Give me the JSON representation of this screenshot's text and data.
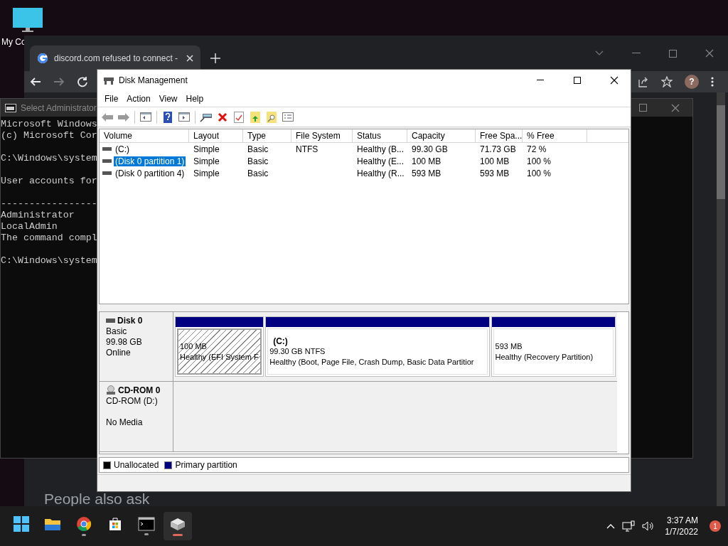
{
  "desktop_icons": [
    {
      "label": "My Co"
    }
  ],
  "browser": {
    "tab": {
      "title": "discord.com refused to connect -"
    },
    "avatar": "?",
    "content": {
      "heading": "People also ask"
    }
  },
  "console": {
    "title": "Select Administrator",
    "groups": [
      [
        "Microsoft Windows",
        "(c) Microsoft Cor"
      ],
      [
        "C:\\Windows\\system"
      ],
      [
        "User accounts for"
      ],
      [
        "-----------------",
        "Administrator",
        "LocalAdmin",
        "The command compl"
      ],
      [
        "C:\\Windows\\system"
      ]
    ]
  },
  "disk_management": {
    "title": "Disk Management",
    "menu": [
      "File",
      "Action",
      "View",
      "Help"
    ],
    "volume_table": {
      "columns": [
        "Volume",
        "Layout",
        "Type",
        "File System",
        "Status",
        "Capacity",
        "Free Spa...",
        "% Free"
      ],
      "rows": [
        {
          "cells": [
            "(C:)",
            "Simple",
            "Basic",
            "NTFS",
            "Healthy (B...",
            "99.30 GB",
            "71.73 GB",
            "72 %"
          ],
          "selected": false
        },
        {
          "cells": [
            "(Disk 0 partition 1)",
            "Simple",
            "Basic",
            "",
            "Healthy (E...",
            "100 MB",
            "100 MB",
            "100 %"
          ],
          "selected": true
        },
        {
          "cells": [
            "(Disk 0 partition 4)",
            "Simple",
            "Basic",
            "",
            "Healthy (R...",
            "593 MB",
            "593 MB",
            "100 %"
          ],
          "selected": false
        }
      ]
    },
    "disks": [
      {
        "kind": "disk",
        "name": "Disk 0",
        "type": "Basic",
        "size": "99.98 GB",
        "status": "Online",
        "partitions": [
          {
            "size": "100 MB",
            "status": "Healthy (EFI System F",
            "selected": true
          },
          {
            "label": "(C:)",
            "size": "99.30 GB NTFS",
            "status": "Healthy (Boot, Page File, Crash Dump, Basic Data Partitior",
            "selected": false
          },
          {
            "size": "593 MB",
            "status": "Healthy (Recovery Partition)",
            "selected": false
          }
        ]
      },
      {
        "kind": "cdrom",
        "name": "CD-ROM 0",
        "type": "CD-ROM (D:)",
        "status": "No Media"
      }
    ],
    "legend": [
      {
        "label": "Unallocated",
        "color": "#000000"
      },
      {
        "label": "Primary partition",
        "color": "#000080"
      }
    ]
  },
  "taskbar": {
    "apps": [
      {
        "kind": "start",
        "running": false,
        "active": false
      },
      {
        "kind": "explorer",
        "running": false,
        "active": false
      },
      {
        "kind": "chrome",
        "running": true,
        "active": false
      },
      {
        "kind": "store",
        "running": false,
        "active": false
      },
      {
        "kind": "terminal",
        "running": true,
        "active": false
      },
      {
        "kind": "disk",
        "running": true,
        "active": true
      }
    ],
    "time": "3:37 AM",
    "date": "1/7/2022",
    "notifications": "1"
  }
}
